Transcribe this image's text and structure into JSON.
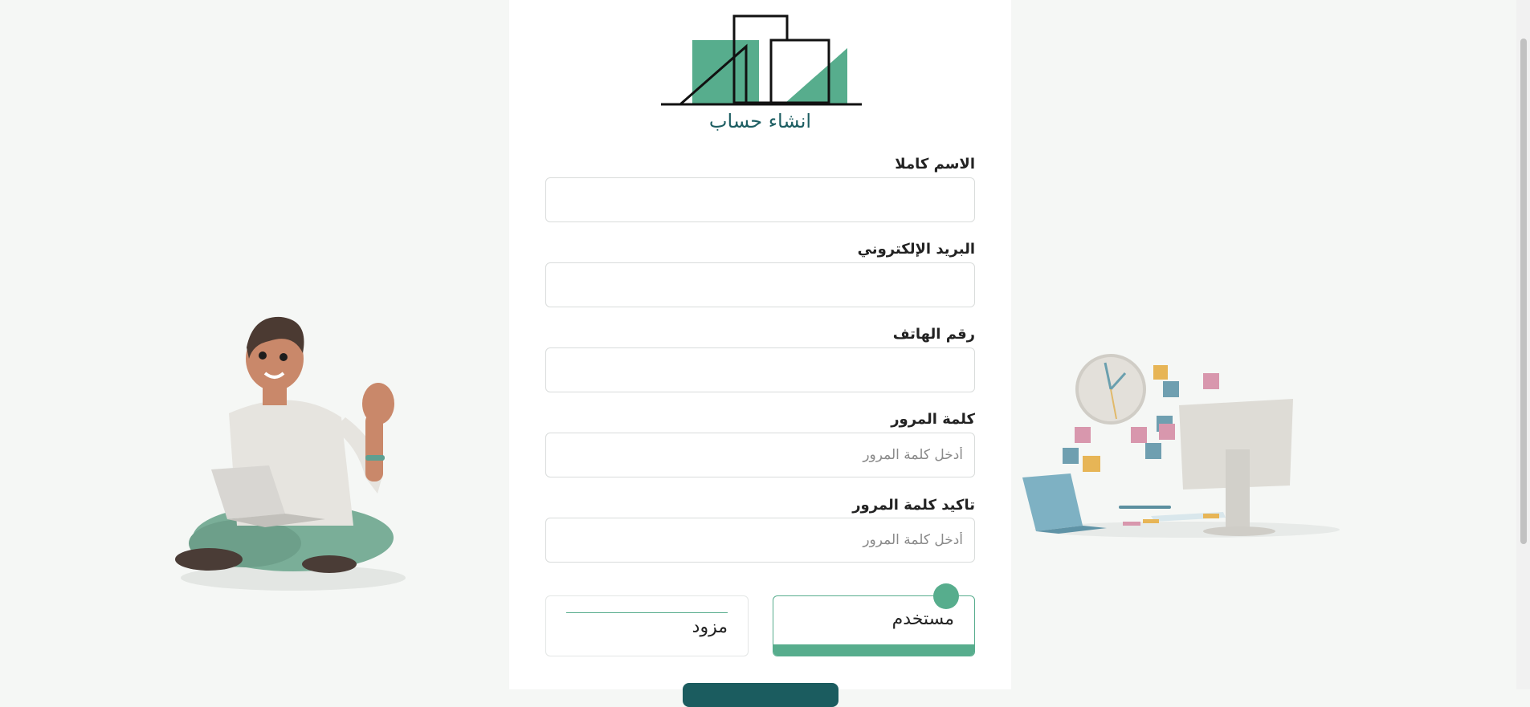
{
  "header": {
    "title": "انشاء حساب"
  },
  "form": {
    "full_name": {
      "label": "الاسم كاملا",
      "value": "",
      "placeholder": ""
    },
    "email": {
      "label": "البريد الإلكتروني",
      "value": "",
      "placeholder": ""
    },
    "phone": {
      "label": "رقم الهاتف",
      "value": "",
      "placeholder": ""
    },
    "password": {
      "label": "كلمة المرور",
      "value": "",
      "placeholder": "أدخل كلمة المرور"
    },
    "confirm_password": {
      "label": "تاكيد كلمة المرور",
      "value": "",
      "placeholder": "أدخل كلمة المرور"
    }
  },
  "role": {
    "user_label": "مستخدم",
    "provider_label": "مزود",
    "selected": "user"
  },
  "icons": {
    "logo": "buildings-logo-icon",
    "left": "person-with-laptop-illustration",
    "right": "workspace-desk-illustration"
  },
  "colors": {
    "accent": "#57ad8d",
    "primary": "#1b5c5f",
    "background": "#f5f7f5"
  }
}
